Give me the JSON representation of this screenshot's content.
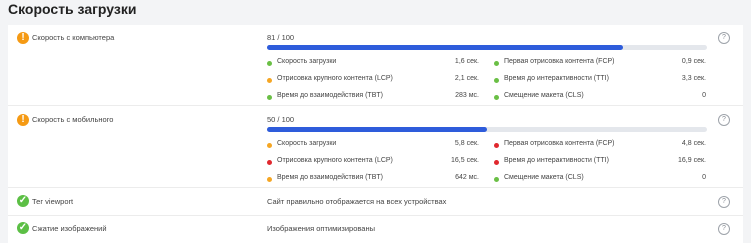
{
  "section_title": "Скорость загрузки",
  "colors": {
    "green": "#6abf45",
    "orange": "#f5a623",
    "red": "#e0282e",
    "bar": "#2e5cdb"
  },
  "desktop": {
    "label": "Скорость с компьютера",
    "status_icon": "warning-icon",
    "score_text": "81 / 100",
    "score": 81,
    "help": "?",
    "metrics_left": [
      {
        "name": "Скорость загрузки",
        "value": "1,6 сек.",
        "status": "green"
      },
      {
        "name": "Отрисовка крупного контента (LCP)",
        "value": "2,1 сек.",
        "status": "orange"
      },
      {
        "name": "Время до взаимодействия (TBT)",
        "value": "283 мс.",
        "status": "green"
      }
    ],
    "metrics_right": [
      {
        "name": "Первая отрисовка контента (FCP)",
        "value": "0,9 сек.",
        "status": "green"
      },
      {
        "name": "Время до интерактивности (TTI)",
        "value": "3,3 сек.",
        "status": "green"
      },
      {
        "name": "Смещение макета (CLS)",
        "value": "0",
        "status": "green"
      }
    ]
  },
  "mobile": {
    "label": "Скорость с мобильного",
    "status_icon": "warning-icon",
    "score_text": "50 / 100",
    "score": 50,
    "help": "?",
    "metrics_left": [
      {
        "name": "Скорость загрузки",
        "value": "5,8 сек.",
        "status": "orange"
      },
      {
        "name": "Отрисовка крупного контента (LCP)",
        "value": "16,5 сек.",
        "status": "red"
      },
      {
        "name": "Время до взаимодействия (TBT)",
        "value": "642 мс.",
        "status": "orange"
      }
    ],
    "metrics_right": [
      {
        "name": "Первая отрисовка контента (FCP)",
        "value": "4,8 сек.",
        "status": "red"
      },
      {
        "name": "Время до интерактивности (TTI)",
        "value": "16,9 сек.",
        "status": "red"
      },
      {
        "name": "Смещение макета (CLS)",
        "value": "0",
        "status": "green"
      }
    ]
  },
  "viewport": {
    "label": "Тег viewport",
    "status_icon": "check-icon",
    "text": "Сайт правильно отображается на всех устройствах",
    "help": "?"
  },
  "images": {
    "label": "Сжатие изображений",
    "status_icon": "check-icon",
    "text": "Изображения оптимизированы",
    "help": "?"
  }
}
